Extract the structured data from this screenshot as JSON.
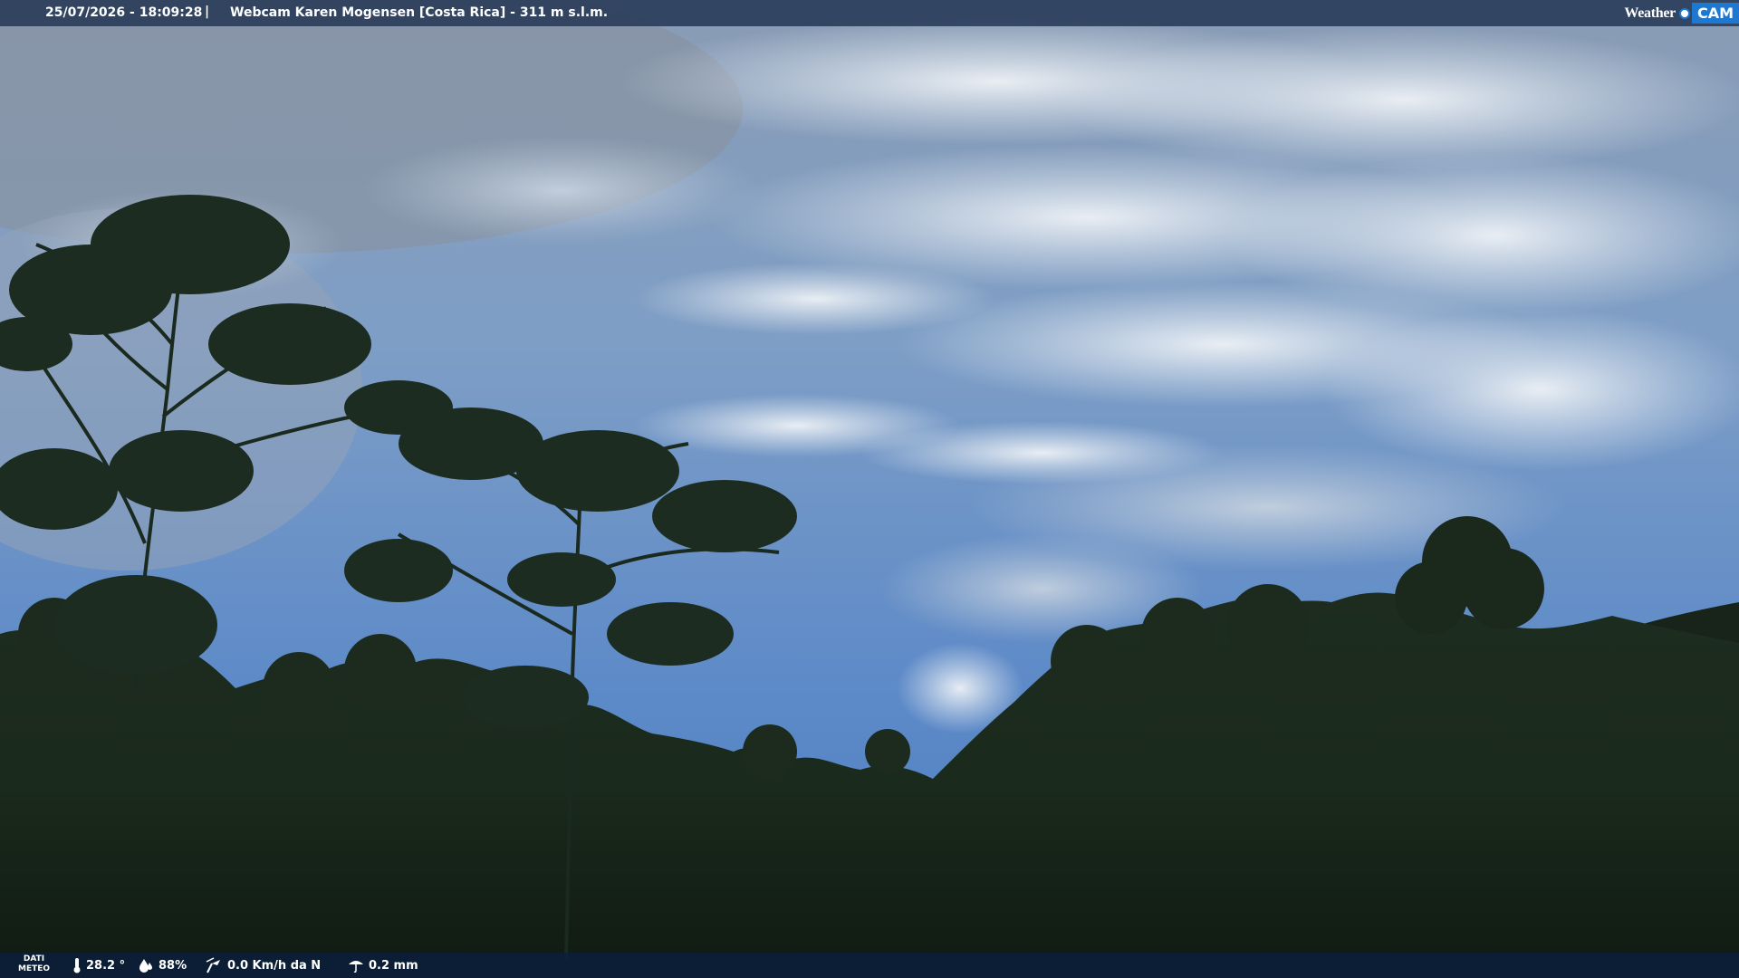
{
  "header": {
    "datetime": "25/07/2026 - 18:09:28",
    "separator": "|",
    "title": "Webcam Karen Mogensen [Costa Rica]  - 311 m s.l.m.",
    "brand_left": "Weather",
    "brand_right": "CAM",
    "brand_color": "#1e78d0"
  },
  "footer": {
    "dati_line1": "DATI",
    "dati_line2": "METEO",
    "temperature": "28.2 °",
    "humidity": "88%",
    "wind": "0.0 Km/h da N",
    "rain": "0.2 mm"
  },
  "icons": [
    "thermometer-icon",
    "humidity-icon",
    "wind-icon",
    "rain-icon"
  ]
}
